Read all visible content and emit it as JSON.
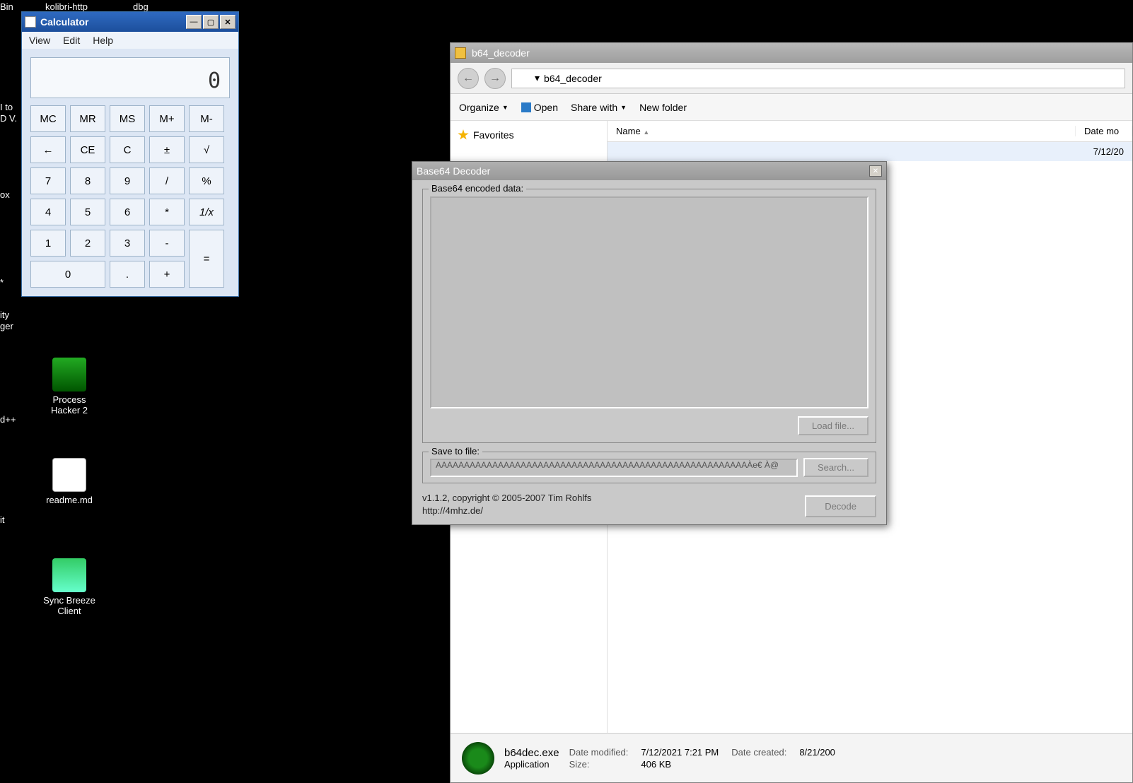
{
  "desktop_fragments": {
    "bin": "Bin",
    "kolibri": "kolibri-http",
    "dbq": "dbg",
    "i_to": "I to",
    "dv": "D V.",
    "ox": "ox",
    "star": "*",
    "ity": "ity",
    "ger": "ger",
    "dpp": "d++",
    "it": "it"
  },
  "desktop_icons": {
    "process_hacker": "Process Hacker 2",
    "readme": "readme.md",
    "sync_breeze": "Sync Breeze Client"
  },
  "calculator": {
    "title": "Calculator",
    "menu": {
      "view": "View",
      "edit": "Edit",
      "help": "Help"
    },
    "display": "0",
    "buttons": {
      "mc": "MC",
      "mr": "MR",
      "ms": "MS",
      "mplus": "M+",
      "mminus": "M-",
      "back": "←",
      "ce": "CE",
      "c": "C",
      "pm": "±",
      "sqrt": "√",
      "7": "7",
      "8": "8",
      "9": "9",
      "div": "/",
      "pct": "%",
      "4": "4",
      "5": "5",
      "6": "6",
      "mul": "*",
      "inv": "1/x",
      "1": "1",
      "2": "2",
      "3": "3",
      "sub": "-",
      "eq": "=",
      "0": "0",
      "dot": ".",
      "add": "+"
    }
  },
  "explorer": {
    "title": "b64_decoder",
    "path": "b64_decoder",
    "toolbar": {
      "organize": "Organize",
      "open": "Open",
      "share": "Share with",
      "newfolder": "New folder"
    },
    "sidebar": {
      "favorites": "Favorites"
    },
    "columns": {
      "name": "Name",
      "date": "Date mo"
    },
    "row": {
      "date_partial": "7/12/20"
    },
    "details": {
      "filename": "b64dec.exe",
      "type": "Application",
      "mod_label": "Date modified:",
      "mod_value": "7/12/2021 7:21 PM",
      "size_label": "Size:",
      "size_value": "406 KB",
      "created_label": "Date created:",
      "created_value": "8/21/200"
    }
  },
  "b64": {
    "title": "Base64 Decoder",
    "encoded_legend": "Base64 encoded data:",
    "load_btn": "Load file...",
    "save_legend": "Save to file:",
    "save_value": "AAAAAAAAAAAAAAAAAAAAAAAAAAAAAAAAAAAAAAAAAAAAAAAAAAAAAAAÀe€ À@",
    "search_btn": "Search...",
    "decode_btn": "Decode",
    "version_line1": "v1.1.2, copyright © 2005-2007 Tim Rohlfs",
    "version_line2": "http://4mhz.de/"
  }
}
